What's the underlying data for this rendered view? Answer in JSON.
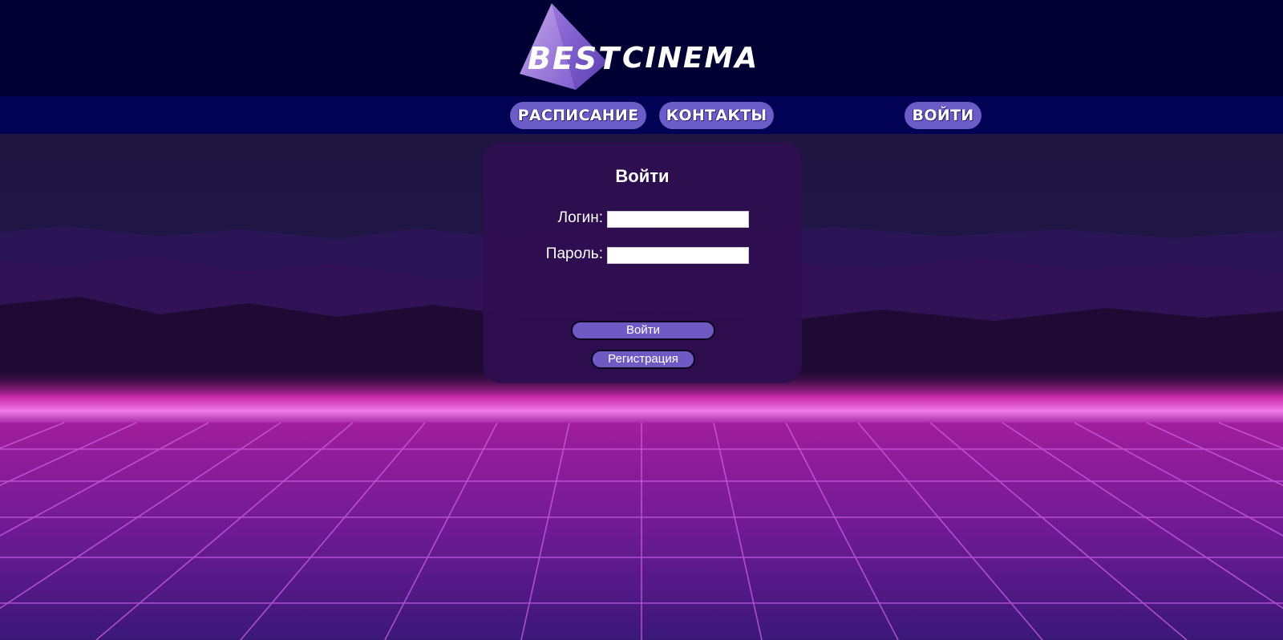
{
  "header": {
    "logo_word1": "BEST",
    "logo_word2": "CINEMA"
  },
  "nav": {
    "schedule": "РАСПИСАНИЕ",
    "contacts": "КОНТАКТЫ",
    "login": "ВОЙТИ"
  },
  "login_form": {
    "title": "Войти",
    "login_label": "Логин:",
    "login_value": "",
    "password_label": "Пароль:",
    "password_value": "",
    "submit_label": "Войти",
    "register_label": "Регистрация"
  },
  "icons": {
    "logo": "pyramid-logo-icon"
  },
  "colors": {
    "header_bg": "#010032",
    "nav_bg": "#020254",
    "pill": "#6b5cc7",
    "card_bg": "#2e0e50",
    "button": "#6e5ac2",
    "grid_glow": "#d04ad6"
  }
}
